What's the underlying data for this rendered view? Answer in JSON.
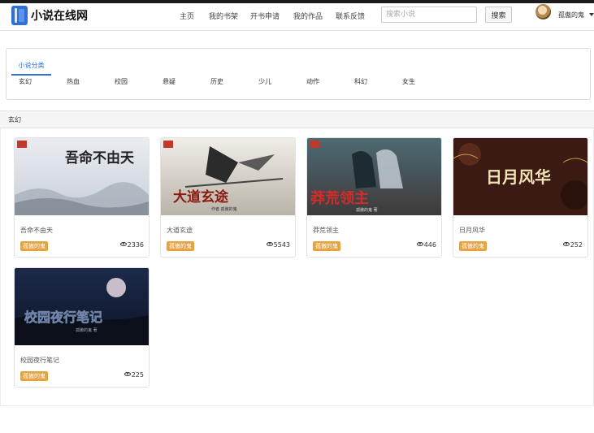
{
  "site": {
    "logo_text": "小说在线网"
  },
  "nav": {
    "links": [
      "主页",
      "我的书架",
      "开书申请",
      "我的作品",
      "联系反馈"
    ],
    "search_placeholder": "搜索小说",
    "search_button": "搜索",
    "username": "孤傲的鬼"
  },
  "categories": {
    "tab_label": "小说分类",
    "items": [
      "玄幻",
      "热血",
      "校园",
      "悬疑",
      "历史",
      "少儿",
      "动作",
      "科幻",
      "女生"
    ]
  },
  "section": {
    "title": "玄幻"
  },
  "books": [
    {
      "name": "吾命不由天",
      "author": "孤傲的鬼",
      "views": "2336",
      "cover_title": "吾命不由天"
    },
    {
      "name": "大道玄途",
      "author": "孤傲的鬼",
      "views": "5543",
      "cover_title": "大道玄途",
      "cover_subtitle": "作者 孤傲的鬼"
    },
    {
      "name": "莽荒领主",
      "author": "孤傲的鬼",
      "views": "446",
      "cover_title": "莽荒领主",
      "cover_subtitle": "孤傲的鬼 著"
    },
    {
      "name": "日月风华",
      "author": "孤傲的鬼",
      "views": "252",
      "cover_title": "日月风华"
    },
    {
      "name": "校园夜行笔记",
      "author": "孤傲的鬼",
      "views": "225",
      "cover_title": "校园夜行笔记",
      "cover_subtitle": "孤傲的鬼 著"
    }
  ],
  "colors": {
    "accent": "#2f6fd6",
    "badge": "#e8a33d"
  }
}
